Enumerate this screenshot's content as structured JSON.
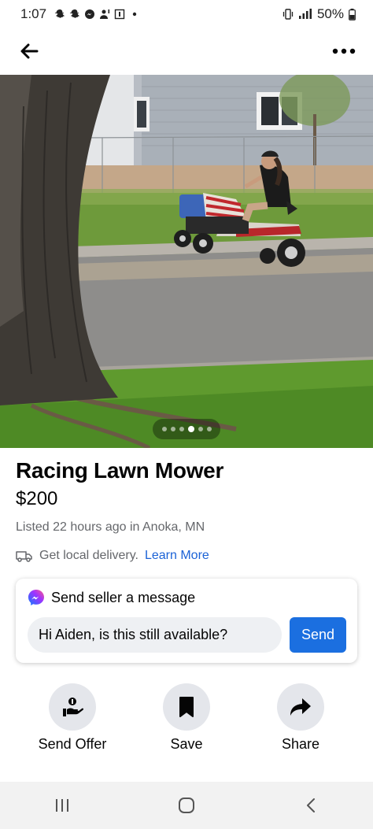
{
  "status_bar": {
    "time": "1:07",
    "battery": "50%",
    "notification_icons": [
      "snapchat-icon",
      "snapchat-icon",
      "messenger-icon",
      "person-alert-icon",
      "gallery-icon",
      "dot-icon"
    ]
  },
  "header": {
    "back_icon": "arrow-left-icon",
    "more_icon": "more-dots-icon"
  },
  "photo": {
    "image_count": 6,
    "active_index": 3
  },
  "listing": {
    "title": "Racing Lawn Mower",
    "price": "$200",
    "listed": "Listed 22 hours ago in Anoka, MN",
    "delivery_text": "Get local delivery.",
    "delivery_link": "Learn More"
  },
  "message": {
    "heading": "Send seller a message",
    "input_value": "Hi Aiden, is this still available?",
    "send_label": "Send"
  },
  "actions": [
    {
      "label": "Send Offer",
      "icon": "offer-icon"
    },
    {
      "label": "Save",
      "icon": "bookmark-icon"
    },
    {
      "label": "Share",
      "icon": "share-icon"
    }
  ],
  "colors": {
    "accent": "#1b6fe0",
    "link": "#1b62d6",
    "secondary_text": "#65676b",
    "action_circle": "#e4e6eb"
  }
}
